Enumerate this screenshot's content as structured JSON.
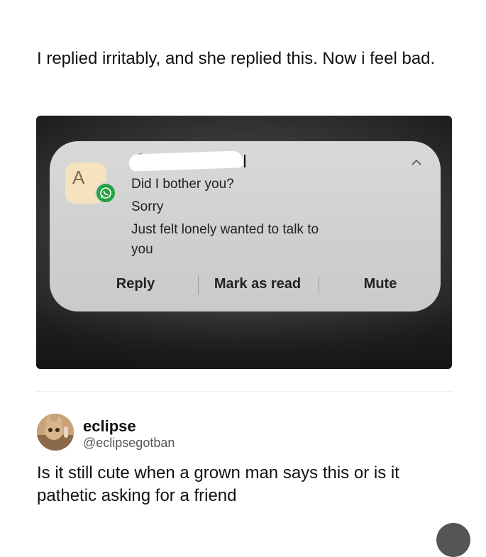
{
  "post": {
    "text": "I replied irritably, and she replied this. Now i feel bad."
  },
  "notification": {
    "app_icon_letter": "A",
    "badge_icon": "whatsapp-icon",
    "lines": [
      "Did I bother you?",
      "Sorry",
      "Just felt lonely wanted to talk to",
      "you"
    ],
    "actions": {
      "reply": "Reply",
      "mark_as_read": "Mark as read",
      "mute": "Mute"
    },
    "colors": {
      "card": "#d4d4d4",
      "badge": "#25a244",
      "icon_bg": "#f7e2bf"
    }
  },
  "reply": {
    "name": "eclipse",
    "handle": "@eclipsegotban",
    "text": "Is it still cute when a grown man says this or is it pathetic asking for a friend"
  }
}
